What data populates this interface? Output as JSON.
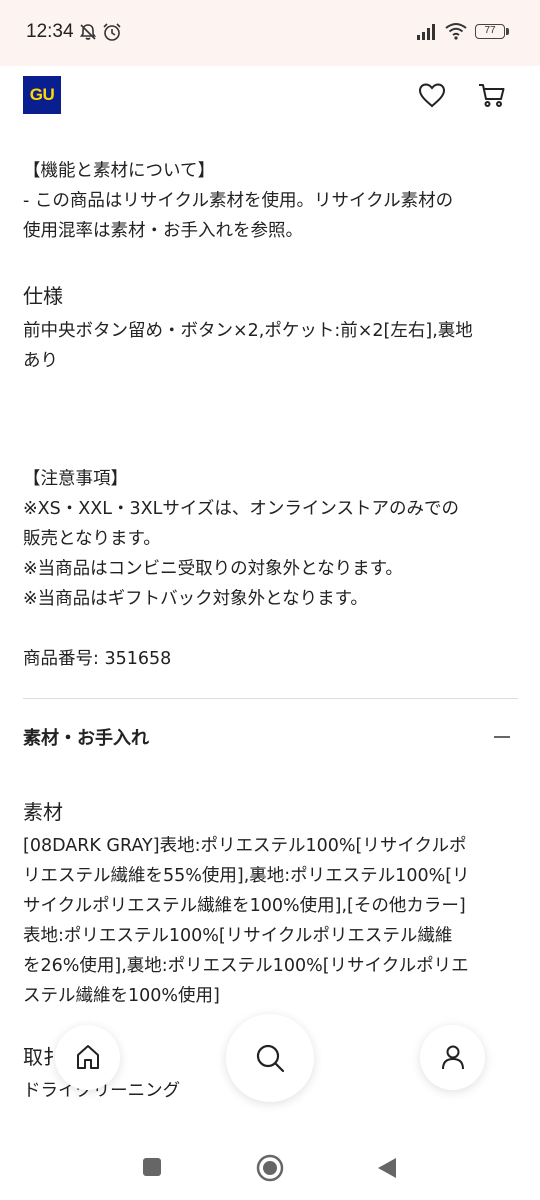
{
  "status_bar": {
    "time": "12:34",
    "battery_level": "77"
  },
  "header": {
    "logo_text": "GU"
  },
  "content": {
    "function_material_line1": "【機能と素材について】",
    "function_material_line2": "- この商品はリサイクル素材を使用。リサイクル素材の",
    "function_material_line3": "使用混率は素材・お手入れを参照。",
    "spec_heading": "仕様",
    "spec_line1": "前中央ボタン留め・ボタン×2,ポケット:前×2[左右],裏地",
    "spec_line2": "あり",
    "notice_line1": "【注意事項】",
    "notice_line2": "※XS・XXL・3XLサイズは、オンラインストアのみでの",
    "notice_line3": "販売となります。",
    "notice_line4": "※当商品はコンビニ受取りの対象外となります。",
    "notice_line5": "※当商品はギフトバック対象外となります。",
    "product_number": "商品番号: 351658",
    "accordion_title": "素材・お手入れ",
    "material_heading": "素材",
    "material_line1": "[08DARK GRAY]表地:ポリエステル100%[リサイクルポ",
    "material_line2": "リエステル繊維を55%使用],裏地:ポリエステル100%[リ",
    "material_line3": "サイクルポリエステル繊維を100%使用],[その他カラー]",
    "material_line4": "表地:ポリエステル100%[リサイクルポリエステル繊維",
    "material_line5": "を26%使用],裏地:ポリエステル100%[リサイクルポリエ",
    "material_line6": "ステル繊維を100%使用]",
    "care_heading_partial": "取扌",
    "care_text_partial": "ドライクリーニング"
  },
  "colors": {
    "logo_bg": "#0a1f8f",
    "logo_text": "#ffd900",
    "status_bar_bg": "#fdf4f2"
  }
}
